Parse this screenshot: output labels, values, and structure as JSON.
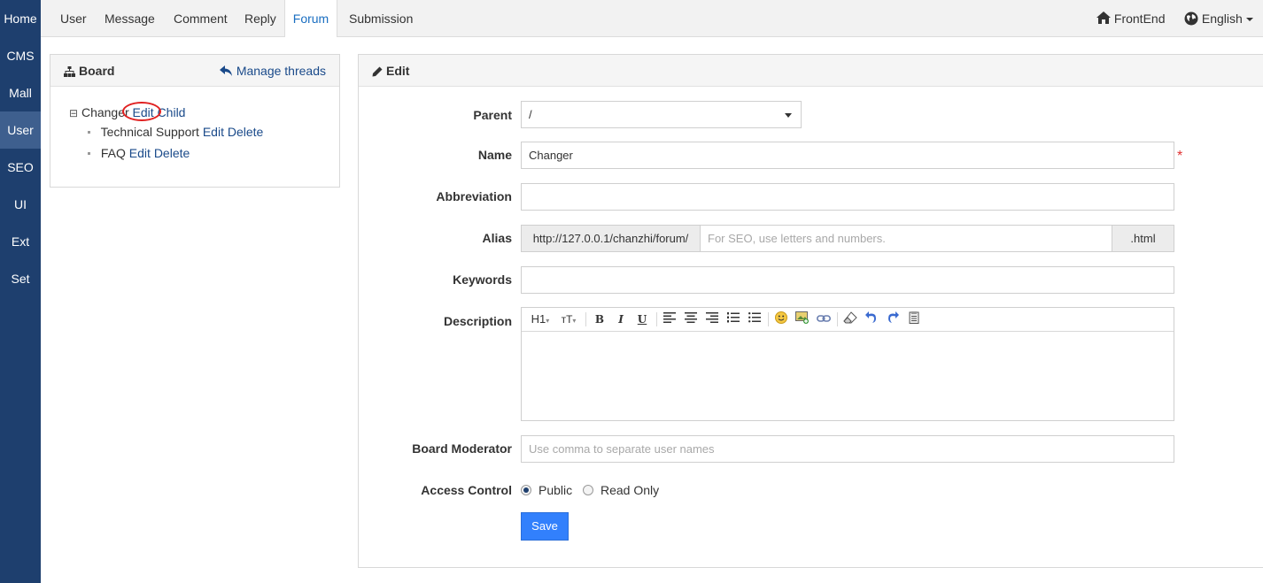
{
  "leftnav": [
    "Home",
    "CMS",
    "Mall",
    "User",
    "SEO",
    "UI",
    "Ext",
    "Set"
  ],
  "topnav": {
    "tabs": [
      "User",
      "Message",
      "Comment",
      "Reply",
      "Forum",
      "Submission"
    ],
    "active": "Forum",
    "frontend": "FrontEnd",
    "language": "English"
  },
  "board": {
    "title": "Board",
    "manage": "Manage threads",
    "tree": {
      "toggle": "⊟",
      "root": "Changer",
      "root_edit": "Edit",
      "root_child": "Child",
      "children": [
        {
          "name": "Technical Support",
          "edit": "Edit",
          "delete": "Delete"
        },
        {
          "name": "FAQ",
          "edit": "Edit",
          "delete": "Delete"
        }
      ]
    }
  },
  "edit": {
    "title": "Edit",
    "parent_label": "Parent",
    "parent_value": "/",
    "name_label": "Name",
    "name_value": "Changer",
    "required_mark": "*",
    "abbr_label": "Abbreviation",
    "abbr_value": "",
    "alias_label": "Alias",
    "alias_prefix": "http://127.0.0.1/chanzhi/forum/",
    "alias_placeholder": "For SEO, use letters and numbers.",
    "alias_suffix": ".html",
    "keywords_label": "Keywords",
    "keywords_value": "",
    "desc_label": "Description",
    "toolbar": {
      "h1": "H1",
      "font": "тT",
      "bold": "B",
      "italic": "I",
      "underline": "U"
    },
    "moderator_label": "Board Moderator",
    "moderator_placeholder": "Use comma to separate user names",
    "access_label": "Access Control",
    "access_public": "Public",
    "access_readonly": "Read Only",
    "access_selected": "Public",
    "save": "Save"
  },
  "colors": {
    "sidebar": "#1e3f6e",
    "sidebar_active": "#3e5f8e",
    "link": "#1a4a8a",
    "save_button": "#3280fc",
    "required": "#e03030",
    "highlight_circle": "#e02020"
  }
}
